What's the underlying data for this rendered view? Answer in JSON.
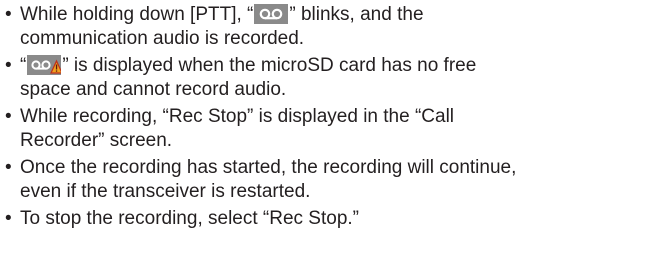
{
  "notes": [
    {
      "bullet": "•",
      "pre": "While holding down [PTT], “",
      "icon": "recording-icon",
      "post": "” blinks, and the",
      "line2": "communication audio is recorded."
    },
    {
      "bullet": "•",
      "pre": "“",
      "icon": "recording-warning-icon",
      "post": "” is displayed when the microSD card has no free",
      "line2": "space and cannot record audio."
    },
    {
      "bullet": "•",
      "line1": "While recording, “Rec Stop” is displayed in the “Call",
      "line2": "Recorder” screen."
    },
    {
      "bullet": "•",
      "line1": "Once the recording has started, the recording will continue,",
      "line2": "even if the transceiver is restarted."
    },
    {
      "bullet": "•",
      "line1": "To stop the recording, select “Rec Stop.”"
    }
  ]
}
